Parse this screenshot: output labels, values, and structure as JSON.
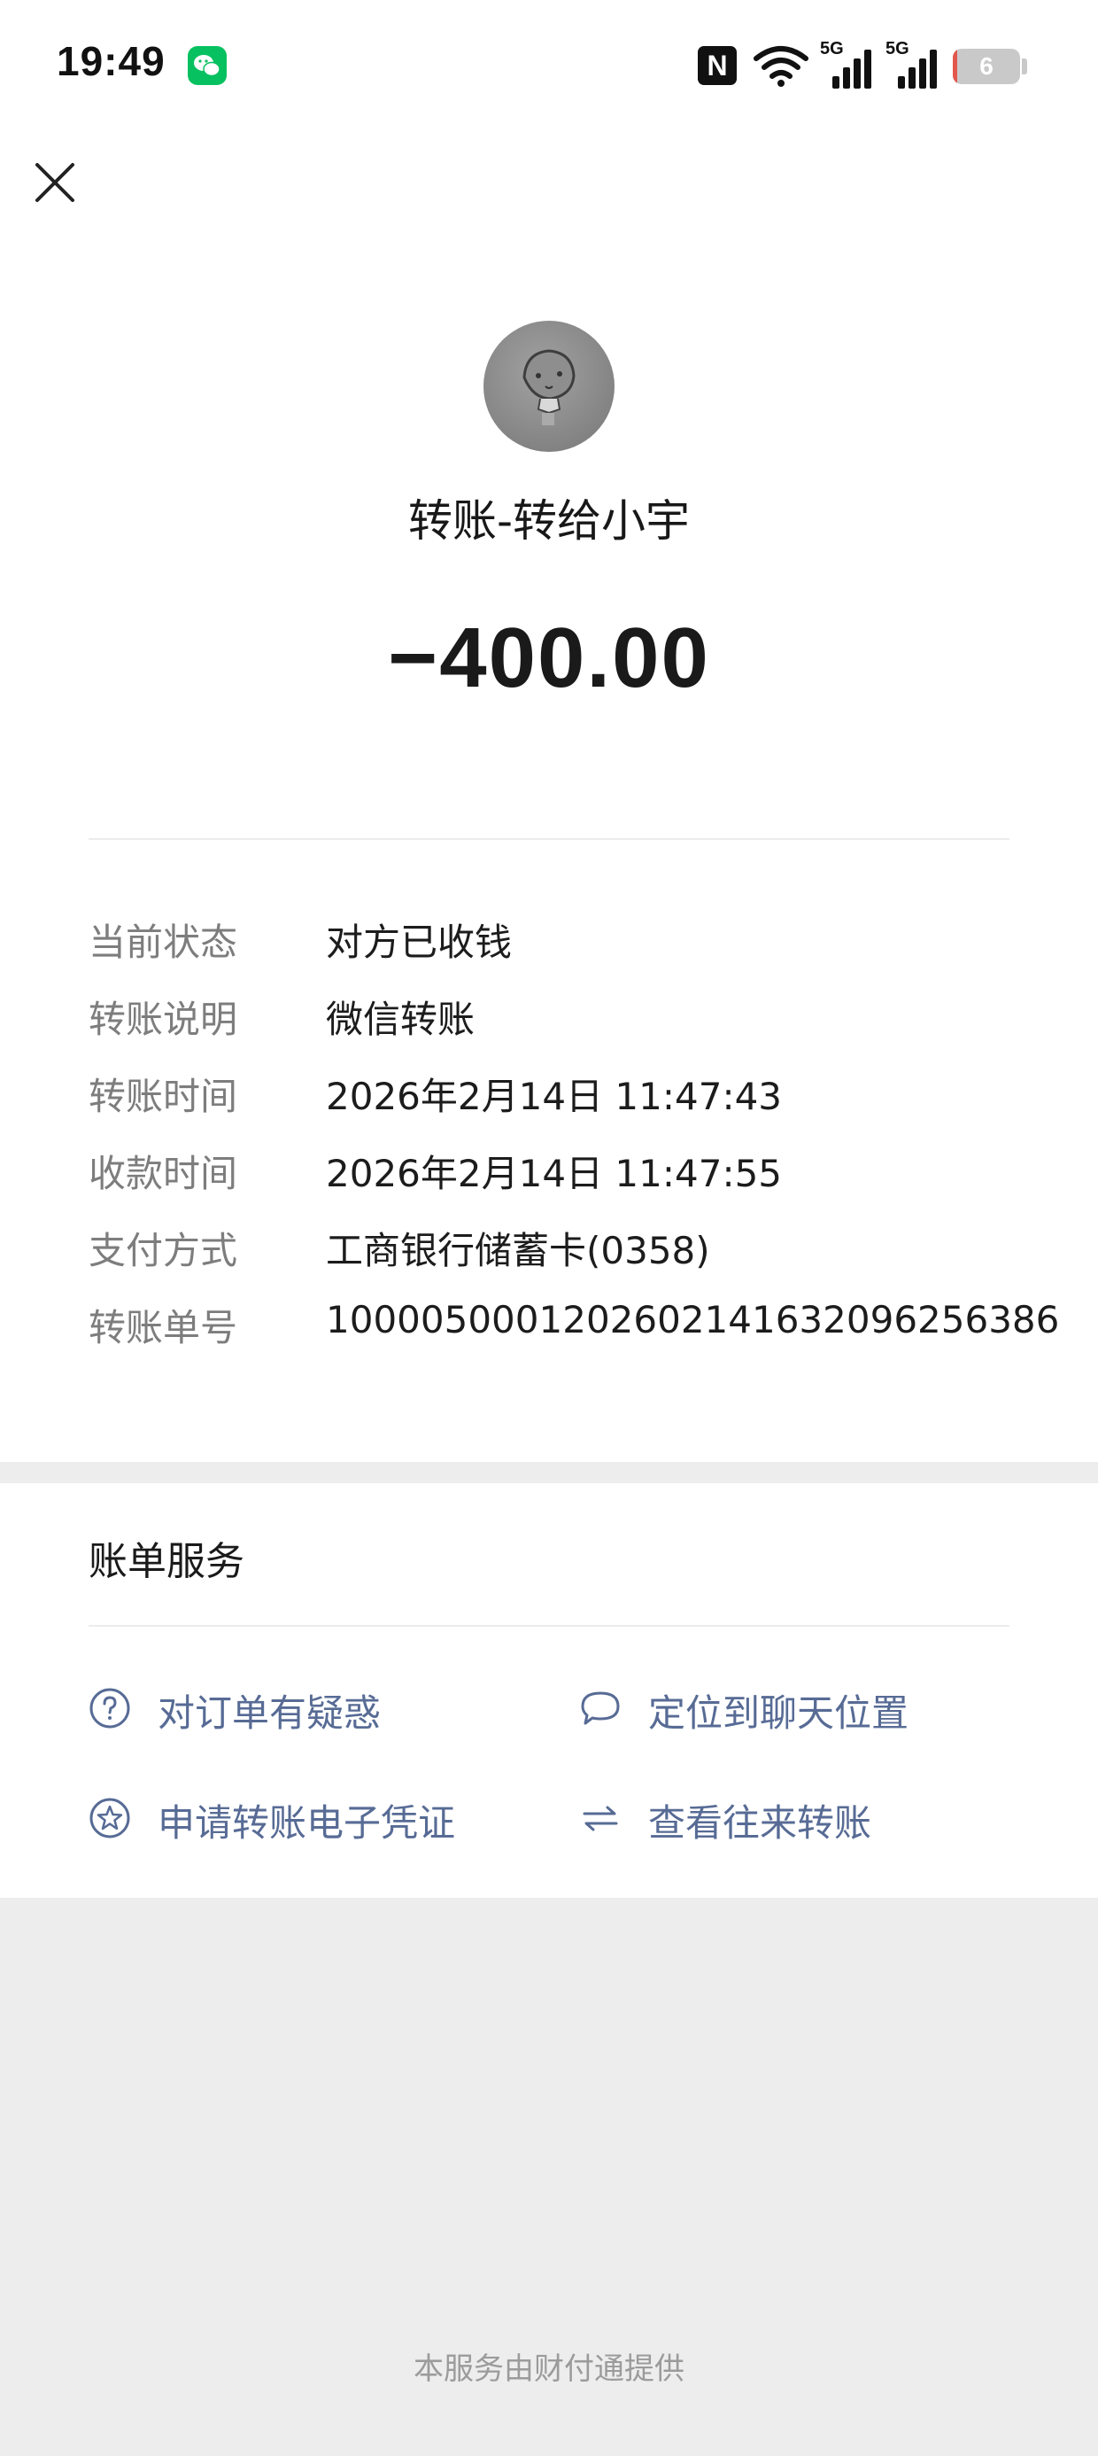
{
  "status_bar": {
    "time": "19:49",
    "nfc_label": "N",
    "signal1_label": "5G",
    "signal2_label": "5G",
    "battery_level": "6",
    "battery_percent": 6
  },
  "header": {
    "close_icon": "close-icon"
  },
  "transfer": {
    "title": "转账-转给小宇",
    "amount": "−400.00"
  },
  "details": [
    {
      "label": "当前状态",
      "value": "对方已收钱"
    },
    {
      "label": "转账说明",
      "value": "微信转账"
    },
    {
      "label": "转账时间",
      "value": "2026年2月14日 11:47:43"
    },
    {
      "label": "收款时间",
      "value": "2026年2月14日 11:47:55"
    },
    {
      "label": "支付方式",
      "value": "工商银行储蓄卡(0358)"
    },
    {
      "label": "转账单号",
      "value": "1000050001202602141632096256386"
    }
  ],
  "services": {
    "title": "账单服务",
    "actions": [
      {
        "label": "对订单有疑惑",
        "icon": "question-circle-icon"
      },
      {
        "label": "定位到聊天位置",
        "icon": "chat-bubble-icon"
      },
      {
        "label": "申请转账电子凭证",
        "icon": "star-circle-icon"
      },
      {
        "label": "查看往来转账",
        "icon": "swap-arrows-icon"
      }
    ]
  },
  "footer": {
    "text": "本服务由财付通提供"
  },
  "colors": {
    "link": "#576b95",
    "wechat_green": "#07c160",
    "page_bg": "#ededed"
  }
}
